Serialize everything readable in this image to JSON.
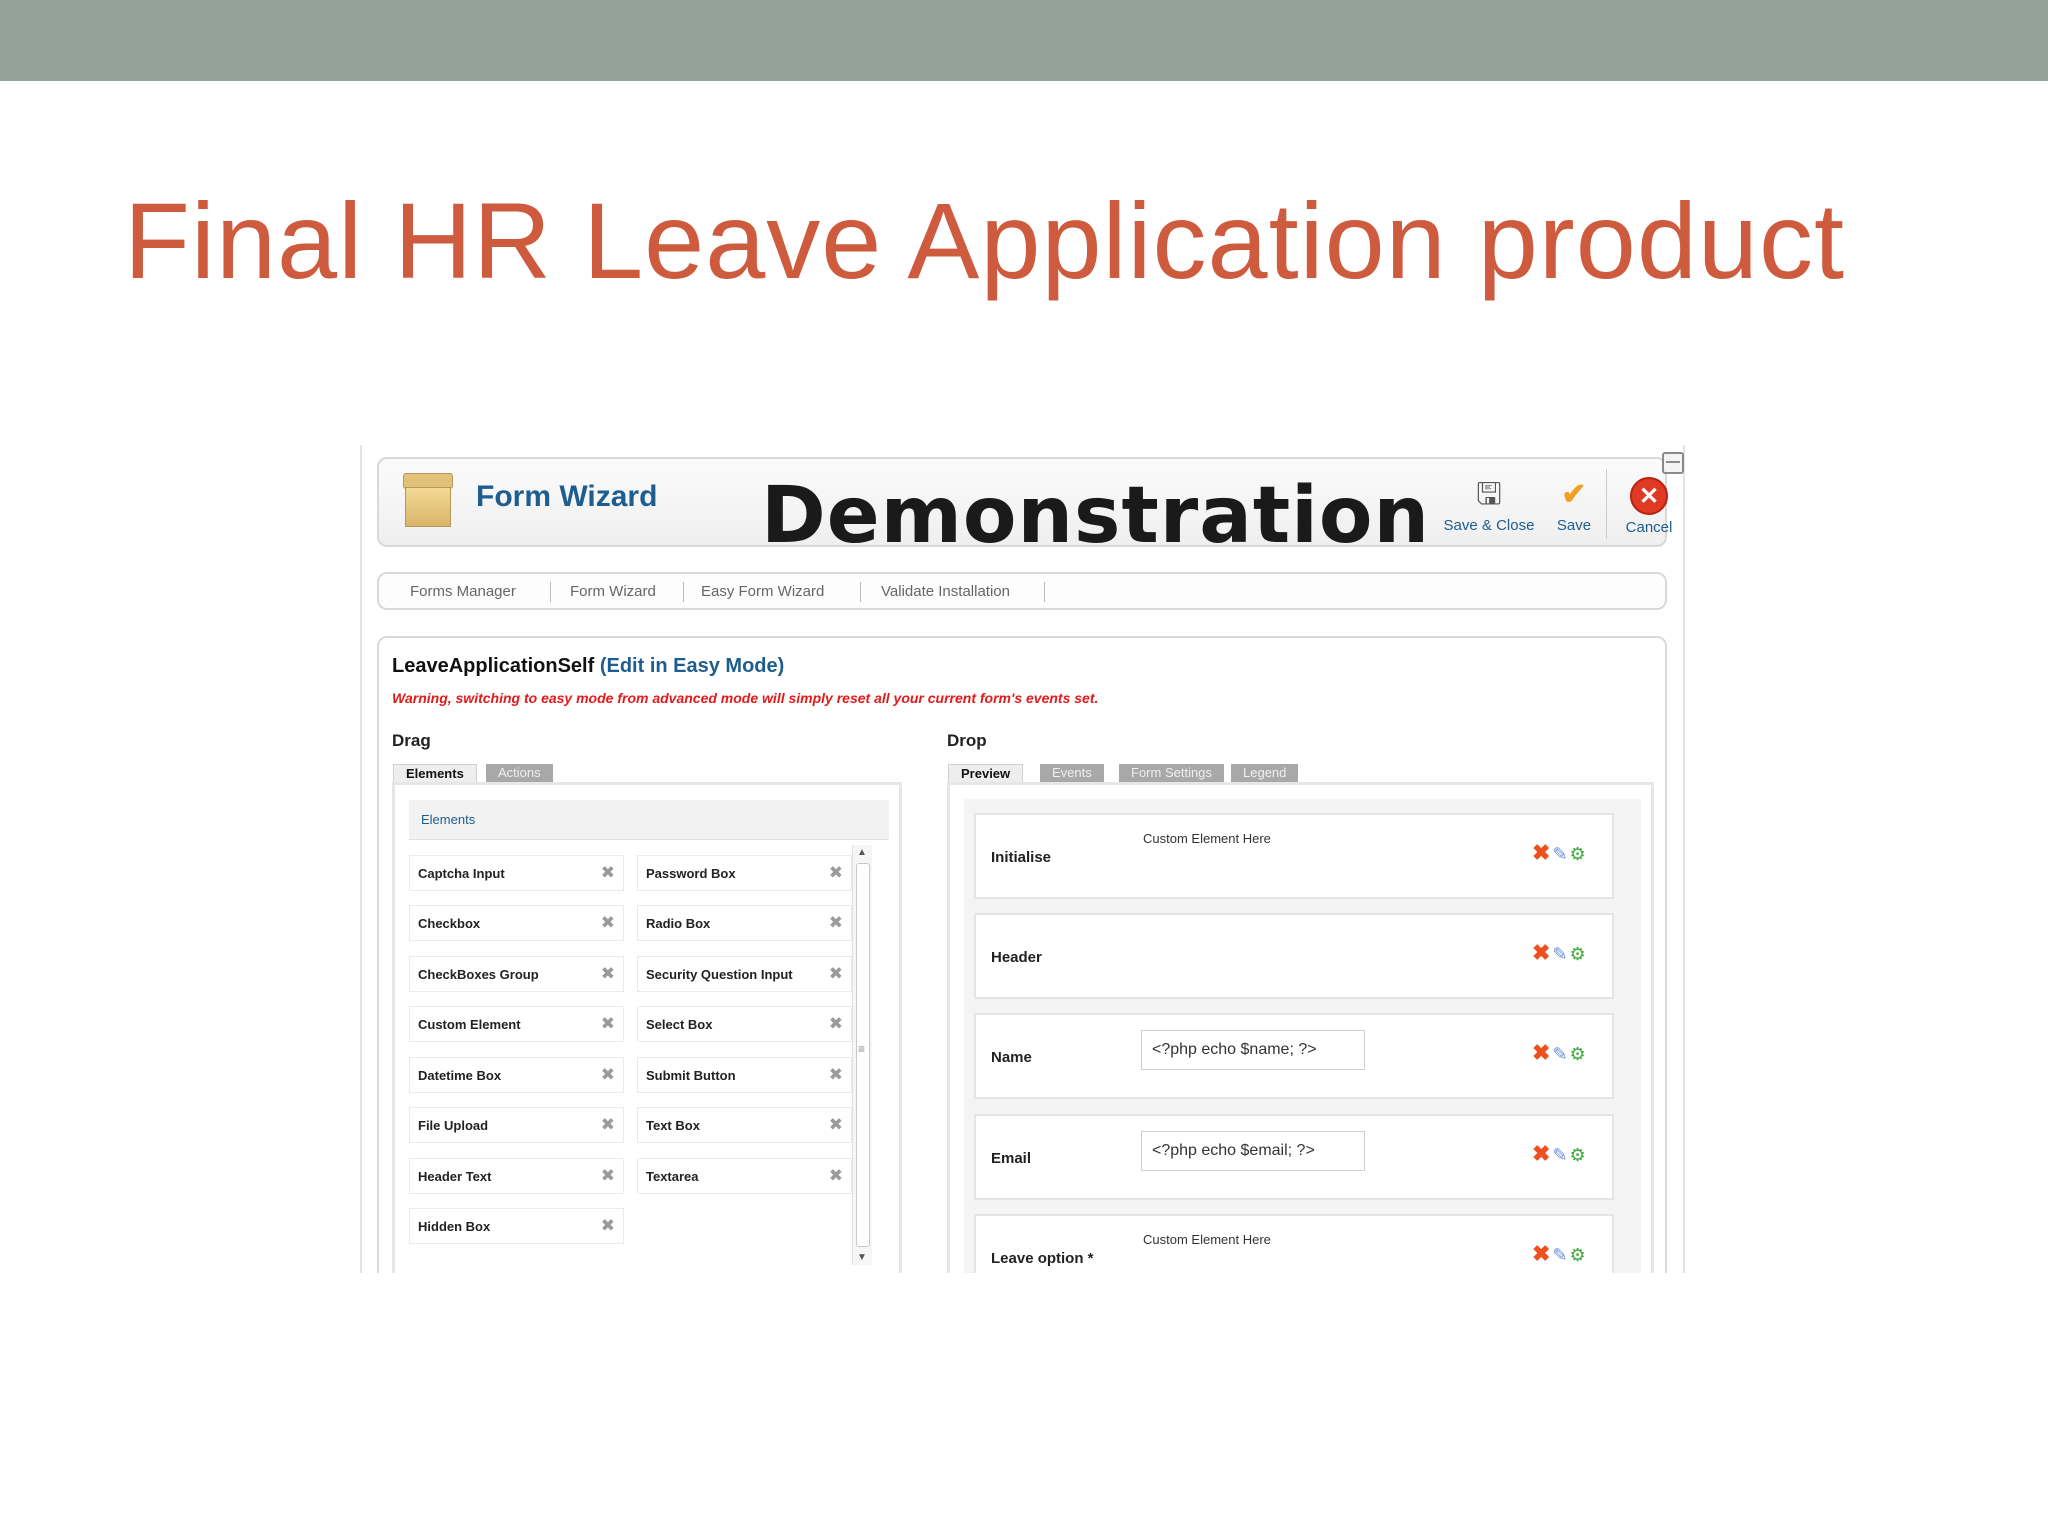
{
  "slide": {
    "title": "Final HR Leave Application product"
  },
  "toolbar": {
    "title": "Form Wizard",
    "overlay_label": "Demonstration",
    "save_close_label": "Save & Close",
    "save_label": "Save",
    "cancel_label": "Cancel"
  },
  "nav": {
    "items": [
      "Forms Manager",
      "Form Wizard",
      "Easy Form Wizard",
      "Validate Installation"
    ]
  },
  "form": {
    "name": "LeaveApplicationSelf",
    "edit_link": "(Edit in Easy Mode)",
    "warning": "Warning, switching to easy mode from advanced mode will simply reset all your current form's events set."
  },
  "drag": {
    "label": "Drag",
    "tabs": [
      "Elements",
      "Actions"
    ],
    "elements_heading": "Elements",
    "elements_left": [
      "Captcha Input",
      "Checkbox",
      "CheckBoxes Group",
      "Custom Element",
      "Datetime Box",
      "File Upload",
      "Header Text",
      "Hidden Box"
    ],
    "elements_right": [
      "Password Box",
      "Radio Box",
      "Security Question Input",
      "Select Box",
      "Submit Button",
      "Text Box",
      "Textarea"
    ]
  },
  "drop": {
    "label": "Drop",
    "tabs": [
      "Preview",
      "Events",
      "Form Settings",
      "Legend"
    ],
    "rows": [
      {
        "label": "Initialise",
        "custom_text": "Custom Element Here",
        "value": ""
      },
      {
        "label": "Header",
        "custom_text": "",
        "value": ""
      },
      {
        "label": "Name",
        "custom_text": "",
        "value": "<?php echo $name; ?>"
      },
      {
        "label": "Email",
        "custom_text": "",
        "value": "<?php echo $email; ?>"
      },
      {
        "label": "Leave option *",
        "custom_text": "Custom Element Here",
        "value": ""
      }
    ]
  },
  "icons": {
    "delete": "delete-x-icon",
    "edit": "edit-icon",
    "settings": "settings-icon",
    "move": "move-icon"
  }
}
